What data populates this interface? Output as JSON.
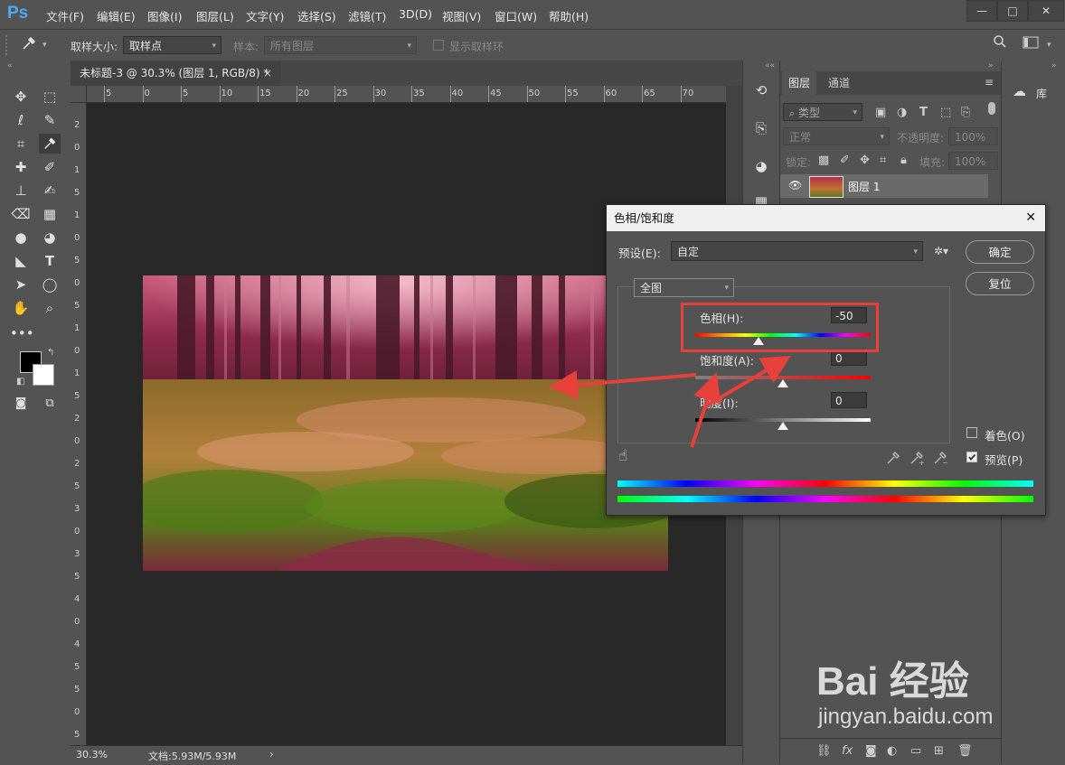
{
  "app": {
    "logo": "Ps",
    "menu": [
      "文件(F)",
      "编辑(E)",
      "图像(I)",
      "图层(L)",
      "文字(Y)",
      "选择(S)",
      "滤镜(T)",
      "3D(D)",
      "视图(V)",
      "窗口(W)",
      "帮助(H)"
    ]
  },
  "options": {
    "sample_size_label": "取样大小:",
    "sample_size_value": "取样点",
    "sample_label": "样本:",
    "sample_value": "所有图层",
    "show_ring_label": "显示取样环"
  },
  "document": {
    "tab_title": "未标题-3 @ 30.3% (图层 1, RGB/8) *",
    "tab_close": "×",
    "ruler_h": [
      "5",
      "0",
      "5",
      "10",
      "15",
      "20",
      "25",
      "30",
      "35",
      "40",
      "45",
      "50",
      "55",
      "60",
      "65",
      "70"
    ],
    "ruler_v": [
      "2",
      "0",
      "1",
      "5",
      "1",
      "0",
      "5",
      "0",
      "5",
      "1",
      "0",
      "1",
      "5",
      "2",
      "0",
      "2",
      "5",
      "3",
      "0",
      "3",
      "5",
      "4",
      "0",
      "4",
      "5",
      "5",
      "0",
      "5",
      "5"
    ],
    "zoom": "30.3%",
    "doc_info": "文档:5.93M/5.93M",
    "nav_arrow": "›"
  },
  "layers_panel": {
    "tabs": [
      "图层",
      "通道"
    ],
    "filter_value": "类型",
    "blend_mode": "正常",
    "opacity_label": "不透明度:",
    "opacity_value": "100%",
    "lock_label": "锁定:",
    "fill_label": "填充:",
    "fill_value": "100%",
    "layer_name": "图层 1",
    "library_label": "库"
  },
  "dialog": {
    "title": "色相/饱和度",
    "close": "✕",
    "preset_label": "预设(E):",
    "preset_value": "自定",
    "channel_value": "全图",
    "hue_label": "色相(H):",
    "hue_value": "-50",
    "saturation_label": "饱和度(A):",
    "saturation_value": "0",
    "lightness_label": "明度(I):",
    "lightness_value": "0",
    "ok_label": "确定",
    "reset_label": "复位",
    "colorize_label": "着色(O)",
    "preview_label": "预览(P)",
    "colorize_checked": false,
    "preview_checked": true
  },
  "watermark": {
    "brand": "Bai 经验",
    "url": "jingyan.baidu.com"
  },
  "colors": {
    "ui_bg": "#535353",
    "canvas_bg": "#282828",
    "accent_red": "#e8403a",
    "ps_blue": "#4fa8ff"
  }
}
